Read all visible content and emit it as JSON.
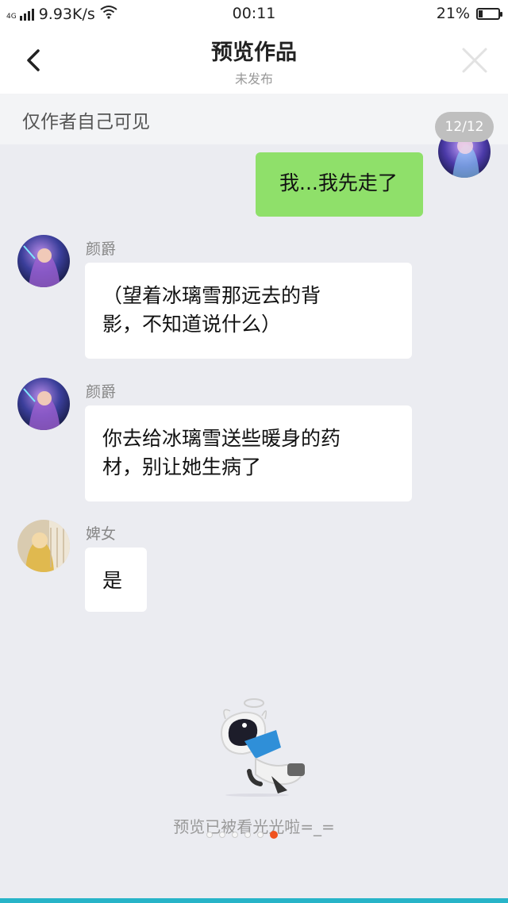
{
  "status_bar": {
    "signal": "4G",
    "speed": "9.93K/s",
    "time": "00:11",
    "battery": "21%",
    "battery_level": 0.21
  },
  "header": {
    "title": "预览作品",
    "subtitle": "未发布"
  },
  "notice": "仅作者自己可见",
  "counter": "12/12",
  "messages": [
    {
      "side": "right",
      "text": "我...我先走了"
    },
    {
      "side": "left",
      "name": "颜爵",
      "text_lines": [
        "（望着冰璃雪那远去的背",
        "影，不知道说什么）"
      ]
    },
    {
      "side": "left",
      "name": "颜爵",
      "text_lines": [
        "你去给冰璃雪送些暖身的药",
        "材，别让她生病了"
      ]
    },
    {
      "side": "left",
      "name": "婢女",
      "text": "是"
    }
  ],
  "end_message": "预览已被看光光啦=_=",
  "pager": {
    "count": 6,
    "active": 5
  },
  "colors": {
    "accent_green": "#8fe06a",
    "dot_active": "#f0531f",
    "bottom_line": "#27b4c8"
  }
}
